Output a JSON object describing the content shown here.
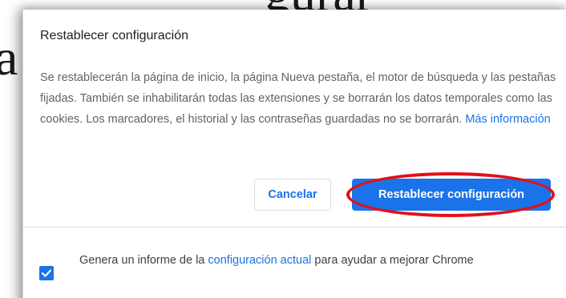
{
  "background": {
    "text_top": "gurar",
    "text_left": "a"
  },
  "dialog": {
    "title": "Restablecer configuración",
    "body_text": "Se restablecerán la página de inicio, la página Nueva pestaña, el motor de búsqueda y las pestañas fijadas. También se inhabilitarán todas las extensiones y se borrarán los datos temporales como las cookies. Los marcadores, el historial y las contraseñas guardadas no se borrarán.",
    "learn_more_link": "Más información",
    "cancel_label": "Cancelar",
    "reset_label": "Restablecer configuración",
    "report": {
      "checked": true,
      "text_before": "Genera un informe de la",
      "link": "configuración actual",
      "text_after": "para ayudar a mejorar Chrome"
    }
  },
  "colors": {
    "accent": "#1a73e8",
    "annotation": "#e3101a"
  },
  "icons": {
    "checkbox": "checkmark-icon"
  }
}
